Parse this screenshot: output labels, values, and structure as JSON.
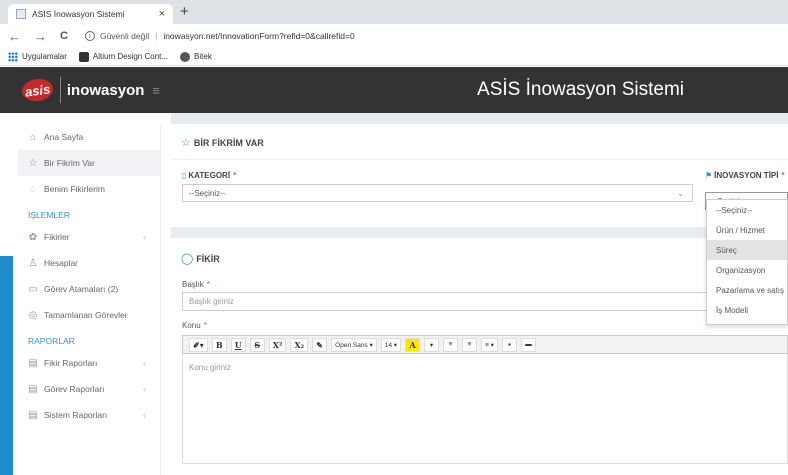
{
  "browser": {
    "tab_title": "ASİS İnowasyon Sistemi",
    "tab_close": "×",
    "new_tab": "+",
    "back": "←",
    "forward": "→",
    "reload": "C",
    "security": "Güvenli değil",
    "separator": "|",
    "url": "inowasyon.net/InnovationForm?refid=0&callrefid=0",
    "bookmarks": [
      {
        "label": "Uygulamalar",
        "icon": "apps-icon"
      },
      {
        "label": "Altium Design Cont...",
        "icon": "altium-icon"
      },
      {
        "label": "Bitek",
        "icon": "bitek-icon"
      }
    ]
  },
  "header": {
    "logo_text": "asis",
    "brand": "inowasyon",
    "menu_icon": "≡",
    "title": "ASİS İnowasyon Sistemi"
  },
  "sidebar": {
    "top_items": [
      {
        "label": "Ana Sayfa",
        "icon": "⌂"
      },
      {
        "label": "Bir Fikrim Var",
        "icon": "☆"
      },
      {
        "label": "Benim Fikirlerim",
        "icon": "◌"
      }
    ],
    "section1": "İŞLEMLER",
    "section1_items": [
      {
        "label": "Fikirler",
        "icon": "✿",
        "chevron": "‹"
      },
      {
        "label": "Hesaplar",
        "icon": "♙"
      },
      {
        "label": "Görev Atamaları (2)",
        "icon": "▭"
      },
      {
        "label": "Tamamlanan Görevler",
        "icon": "◎"
      }
    ],
    "section2": "RAPORLAR",
    "section2_items": [
      {
        "label": "Fikir Raporları",
        "icon": "▤",
        "chevron": "‹"
      },
      {
        "label": "Görev Raporları",
        "icon": "▤",
        "chevron": "‹"
      },
      {
        "label": "Sistem Raporları",
        "icon": "▤",
        "chevron": "‹"
      }
    ]
  },
  "form": {
    "card1_title": "BİR FİKRİM VAR",
    "card1_icon": "☆",
    "kategori_label": "KATEGORİ",
    "kategori_value": "--Seçiniz--",
    "tip_label": "İNOVASYON TİPİ",
    "tip_value": "--Seçiniz--",
    "required": "*",
    "arrow": "⌄",
    "card2_title": "FİKİR",
    "card2_icon": "◯",
    "baslik_label": "Başlık",
    "baslik_placeholder": "Başlık giriniz",
    "konu_label": "Konu",
    "konu_placeholder": "Konu giriniz"
  },
  "toolbar": {
    "buttons": [
      "✐▾",
      "B",
      "U",
      "S",
      "X²",
      "X₂",
      "✎",
      "Open Sans ▾",
      "14 ▾",
      "A",
      "▾",
      "≡",
      "≡",
      "≡ ▾",
      "⚭",
      "▬"
    ]
  },
  "dropdown": {
    "options": [
      "--Seçiniz--",
      "Ürün / Hizmet",
      "Süreç",
      "Organizasyon",
      "Pazarlama ve satış",
      "İş Modeli"
    ],
    "selected_index": 2
  }
}
